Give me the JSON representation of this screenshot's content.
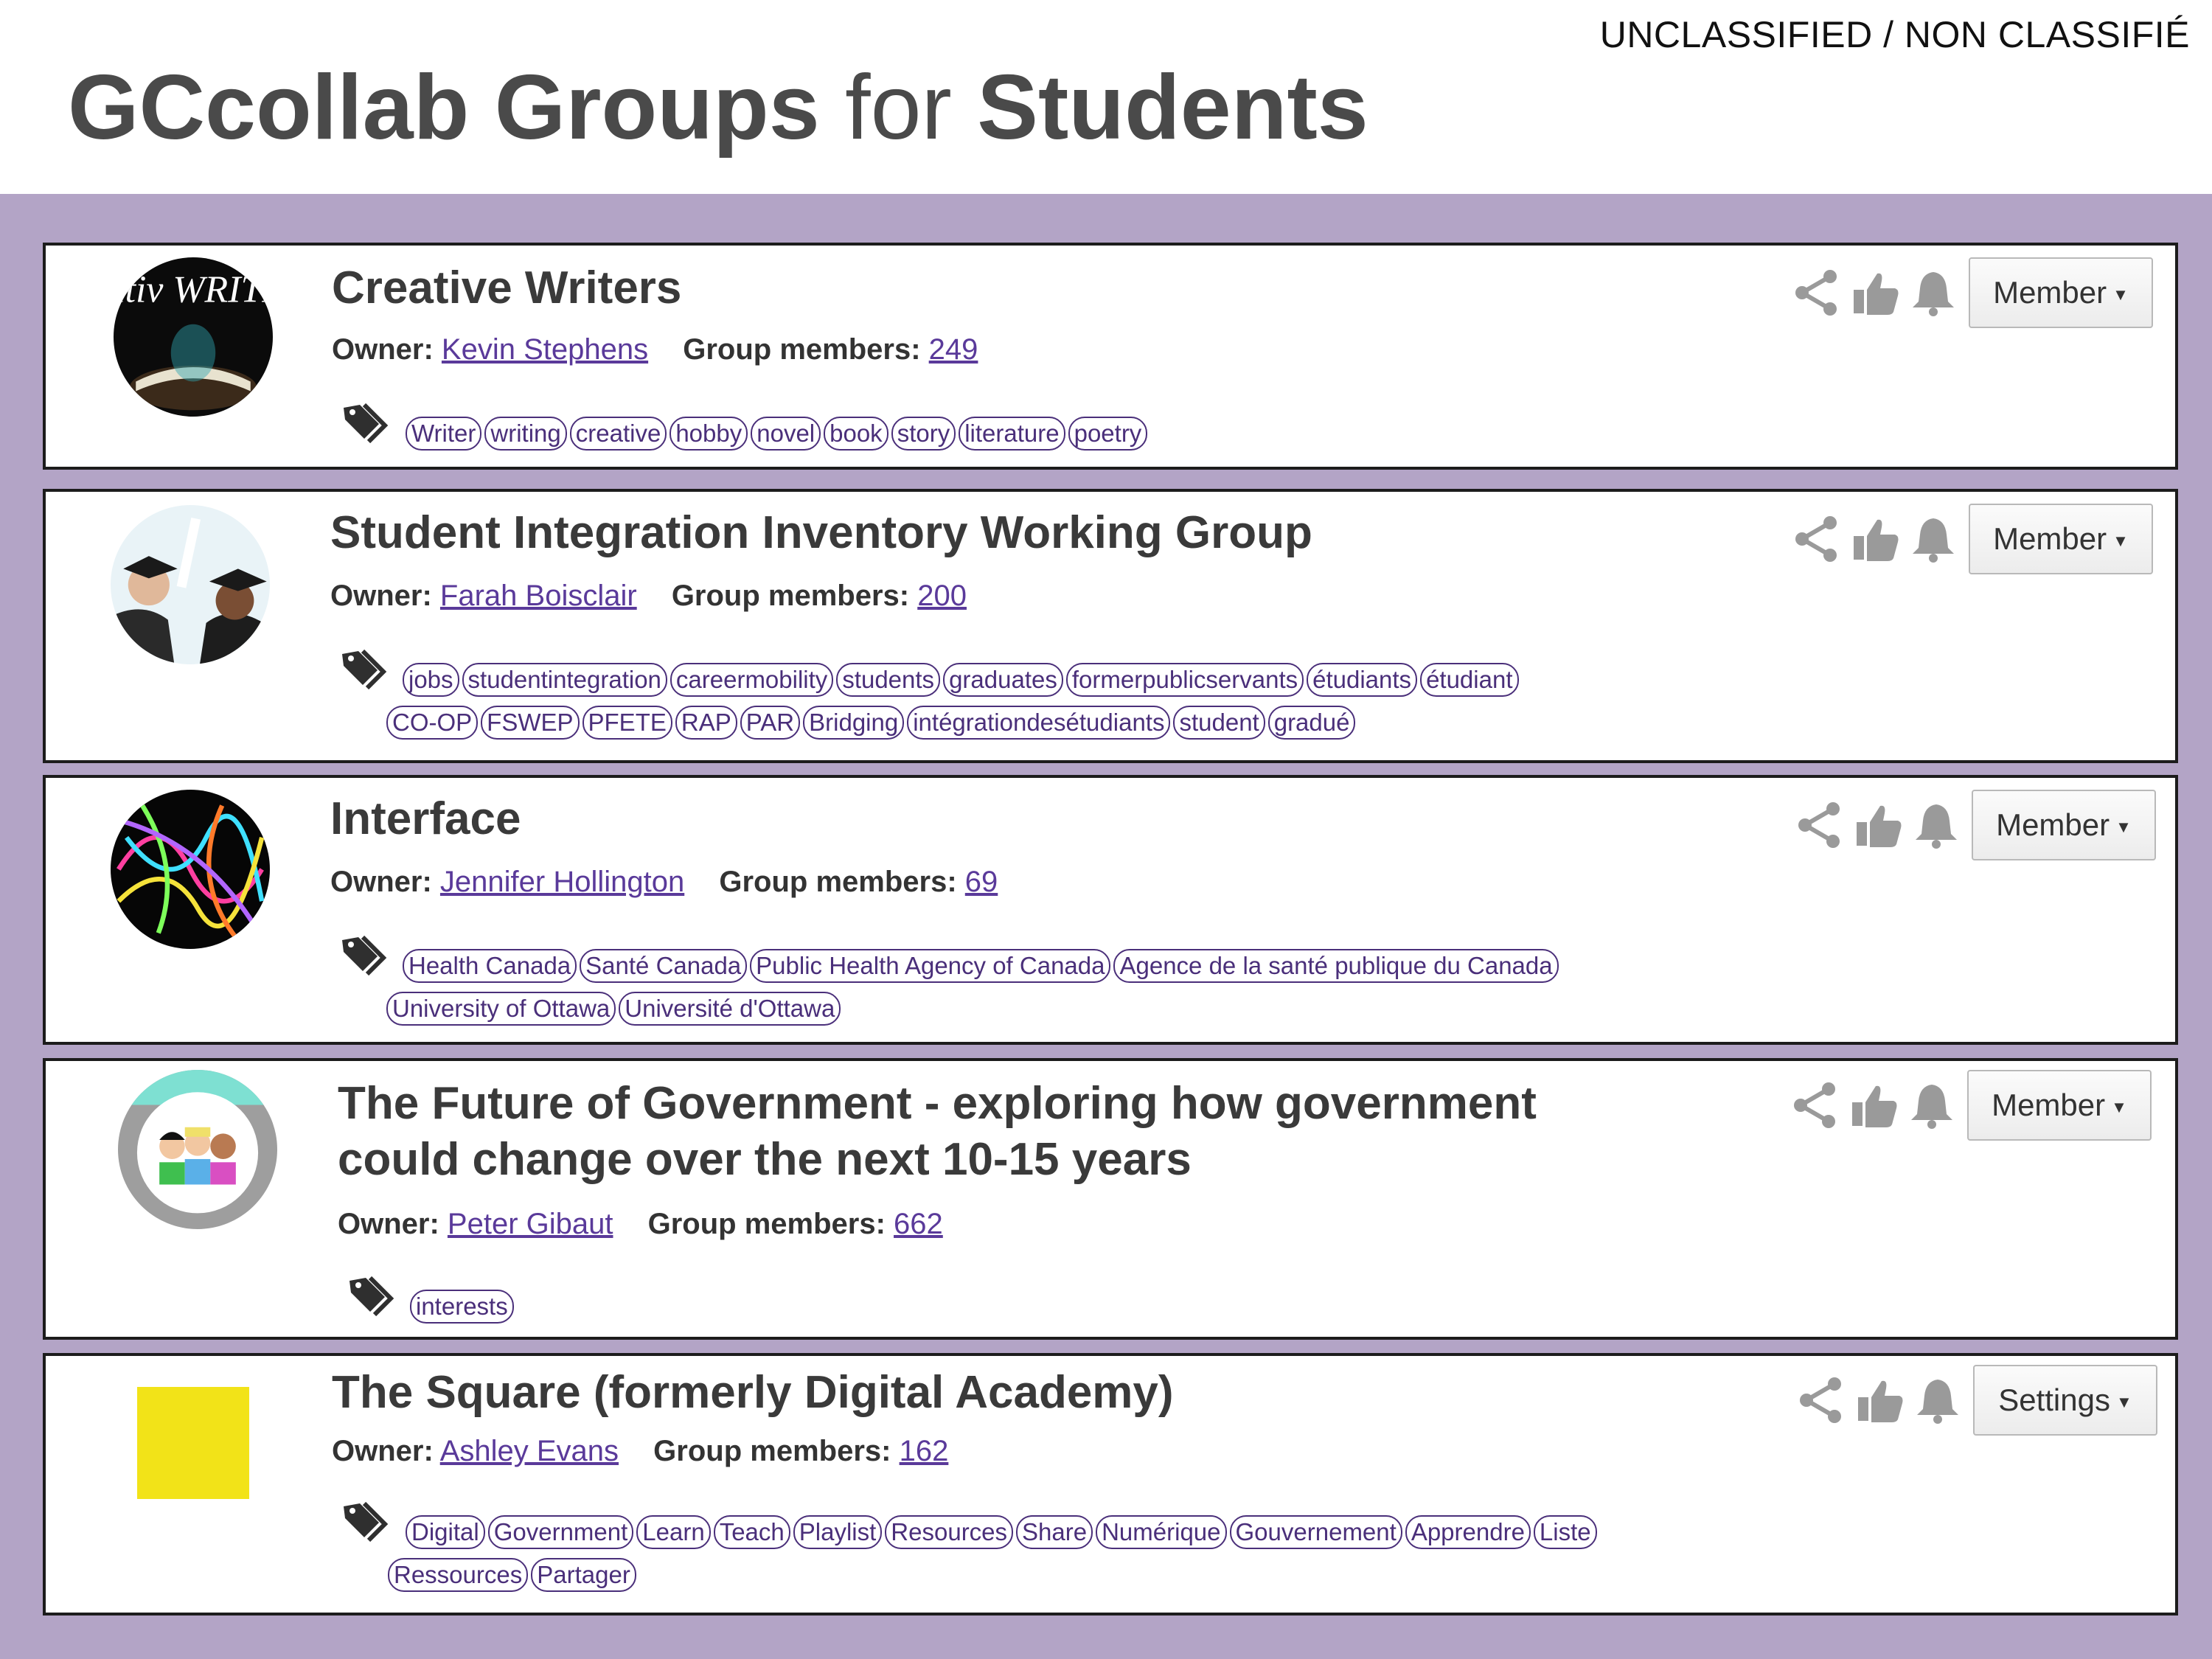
{
  "classification": "UNCLASSIFIED / NON CLASSIFIÉ",
  "title": {
    "part1": "GCcollab Groups",
    "part2": "for",
    "part3": "Students"
  },
  "labels": {
    "owner": "Owner:",
    "members": "Group members:"
  },
  "icons": {
    "tag": "tag-icon",
    "share": "share-icon",
    "like": "thumbs-up-icon",
    "notify": "bell-icon"
  },
  "colors": {
    "panel": "#b3a4c6",
    "tag_border": "#4a2f7a",
    "link": "#5a3a9a",
    "square_logo": "#f2e318"
  },
  "groups": [
    {
      "name": "Creative Writers",
      "owner": "Kevin Stephens",
      "members": "249",
      "action": "Member",
      "avatar_text": "creativ WRITING",
      "tags": [
        [
          "Writer",
          "writing",
          "creative",
          "hobby",
          "novel",
          "book",
          "story",
          "literature",
          "poetry"
        ]
      ]
    },
    {
      "name": "Student Integration Inventory Working Group",
      "owner": "Farah Boisclair",
      "members": "200",
      "action": "Member",
      "tags": [
        [
          "jobs",
          "studentintegration",
          "careermobility",
          "students",
          "graduates",
          "formerpublicservants",
          "étudiants",
          "étudiant"
        ],
        [
          "CO-OP",
          "FSWEP",
          "PFETE",
          "RAP",
          "PAR",
          "Bridging",
          "intégrationdesétudiants",
          "student",
          "gradué"
        ]
      ]
    },
    {
      "name": "Interface",
      "owner": "Jennifer Hollington",
      "members": "69",
      "action": "Member",
      "tags": [
        [
          "Health Canada",
          "Santé Canada",
          "Public Health Agency of Canada",
          "Agence de la santé publique du Canada"
        ],
        [
          "University of Ottawa",
          "Université d'Ottawa"
        ]
      ]
    },
    {
      "name_lines": [
        "The Future of Government - exploring how government",
        "could change over the next 10-15 years"
      ],
      "owner": "Peter Gibaut",
      "members": "662",
      "action": "Member",
      "tags": [
        [
          "interests"
        ]
      ]
    },
    {
      "name": "The Square (formerly Digital Academy)",
      "owner": "Ashley Evans",
      "members": "162",
      "action": "Settings",
      "tags": [
        [
          "Digital",
          "Government",
          "Learn",
          "Teach",
          "Playlist",
          "Resources",
          "Share",
          "Numérique",
          "Gouvernement",
          "Apprendre",
          "Liste"
        ],
        [
          "Ressources",
          "Partager"
        ]
      ]
    }
  ]
}
